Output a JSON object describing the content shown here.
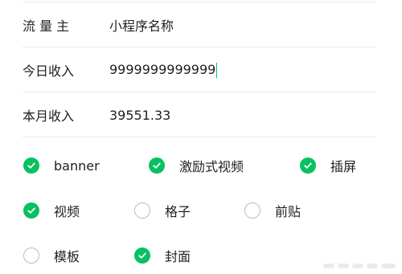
{
  "form": {
    "traffic_owner": {
      "label": "流 量 主",
      "value": "小程序名称"
    },
    "today_income": {
      "label": "今日收入",
      "value": "9999999999999"
    },
    "month_income": {
      "label": "本月收入",
      "value": "39551.33"
    }
  },
  "ad_types": [
    {
      "label": "banner",
      "checked": true
    },
    {
      "label": "激励式视频",
      "checked": true
    },
    {
      "label": "插屏",
      "checked": true
    },
    {
      "label": "视频",
      "checked": true
    },
    {
      "label": "格子",
      "checked": false
    },
    {
      "label": "前贴",
      "checked": false
    },
    {
      "label": "模板",
      "checked": false
    },
    {
      "label": "封面",
      "checked": true
    }
  ],
  "colors": {
    "accent": "#07c160",
    "divider": "#ececec",
    "unchecked_border": "#bdbdbd"
  },
  "icons": {
    "checked": "check-circle-icon",
    "unchecked": "empty-circle-icon"
  }
}
